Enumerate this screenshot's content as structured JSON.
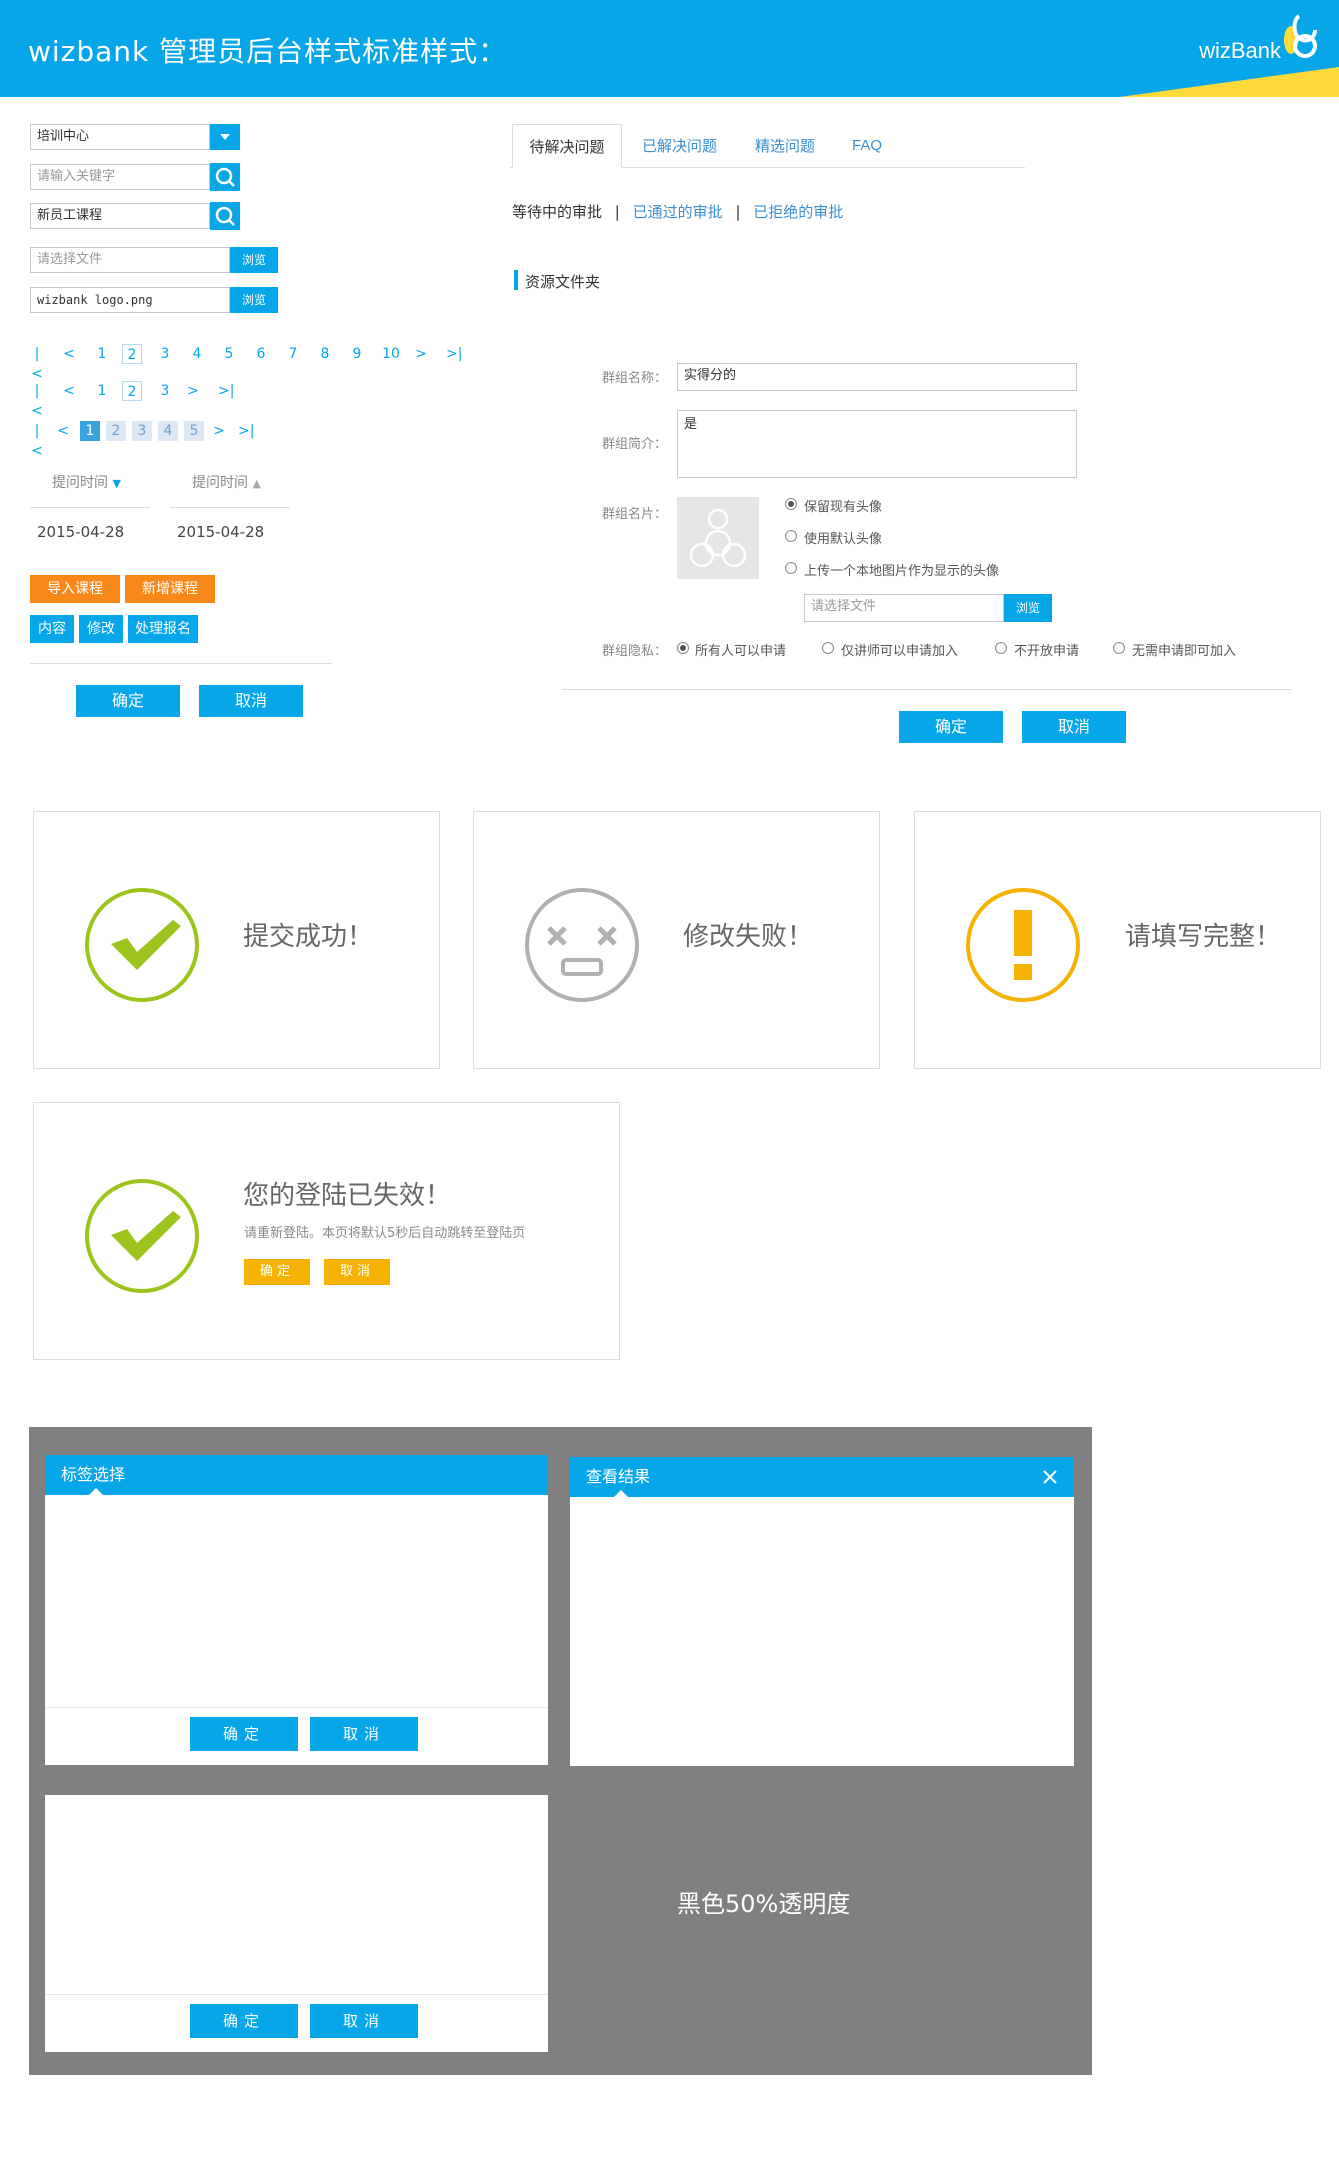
{
  "header": {
    "title": "wizbank 管理员后台样式标准样式：",
    "logo": "wizBank",
    "colors": {
      "primary": "#06a6e8",
      "accent": "#ffd83a"
    }
  },
  "left": {
    "select": {
      "value": "培训中心"
    },
    "search1": {
      "placeholder": "请输入关键字"
    },
    "search2": {
      "value": "新员工课程"
    },
    "file1": {
      "placeholder": "请选择文件",
      "browse": "浏览"
    },
    "file2": {
      "value": "wizbank logo.png",
      "browse": "浏览"
    },
    "pager1": {
      "pages": [
        "1",
        "2",
        "3",
        "4",
        "5",
        "6",
        "7",
        "8",
        "9",
        "10"
      ],
      "current": "2"
    },
    "pager2": {
      "pages": [
        "1",
        "2",
        "3"
      ],
      "current": "2"
    },
    "pager3": {
      "pages": [
        "1",
        "2",
        "3",
        "4",
        "5"
      ],
      "current": "1"
    },
    "sort": {
      "col1": "提问时间",
      "col2": "提问时间",
      "row1": "2015-04-28",
      "row2": "2015-04-28"
    },
    "orange_buttons": [
      "导入课程",
      "新增课程"
    ],
    "blue_buttons": [
      "内容",
      "修改",
      "处理报名"
    ],
    "confirm": "确定",
    "cancel": "取消"
  },
  "right": {
    "tabs": [
      "待解决问题",
      "已解决问题",
      "精选问题",
      "FAQ"
    ],
    "subnav": [
      "等待中的审批",
      "已通过的审批",
      "已拒绝的审批"
    ],
    "section_title": "资源文件夹",
    "form": {
      "name_label": "群组名称：",
      "name_value": "实得分的",
      "intro_label": "群组简介：",
      "intro_value": "是",
      "photo_label": "群组名片：",
      "photo_options": [
        "保留现有头像",
        "使用默认头像",
        "上传一个本地图片作为显示的头像"
      ],
      "file_placeholder": "请选择文件",
      "browse": "浏览",
      "privacy_label": "群组隐私：",
      "privacy_options": [
        "所有人可以申请",
        "仅讲师可以申请加入",
        "不开放申请",
        "无需申请即可加入"
      ]
    },
    "confirm": "确定",
    "cancel": "取消"
  },
  "messages": {
    "success": "提交成功！",
    "fail": "修改失败！",
    "warn": "请填写完整！",
    "expired_title": "您的登陆已失效！",
    "expired_desc": "请重新登陆。本页将默认5秒后自动跳转至登陆页",
    "expired_confirm": "确定",
    "expired_cancel": "取消",
    "colors": {
      "success": "#9dc41c",
      "fail": "#b0b0b0",
      "warn": "#f6b200"
    }
  },
  "dialogs": {
    "d1_title": "标签选择",
    "d2_title": "查看结果",
    "ok": "确定",
    "cancel": "取消",
    "overlay_note": "黑色50%透明度"
  }
}
